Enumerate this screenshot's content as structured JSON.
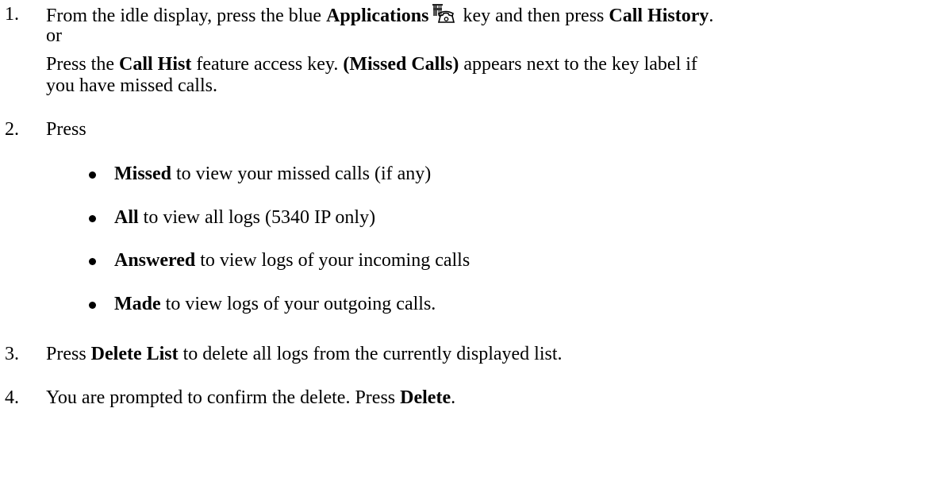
{
  "steps": [
    {
      "number": "1.",
      "line1": {
        "a": "From the idle display, press the blue ",
        "b": "Applications",
        "c": " key and then press ",
        "d": "Call History",
        "e": "."
      },
      "or": "or",
      "line3": {
        "a": "Press the ",
        "b": "Call Hist",
        "c": " feature access key. ",
        "d": "(Missed Calls)",
        "e": " appears next to the key label if"
      },
      "line4": "you have missed calls."
    },
    {
      "number": "2.",
      "text": "Press",
      "bullets": [
        {
          "bold": "Missed",
          "rest": " to view your missed calls (if any)"
        },
        {
          "bold": "All",
          "rest": " to view all logs (5340 IP only)"
        },
        {
          "bold": "Answered",
          "rest": " to view logs of your incoming calls"
        },
        {
          "bold": "Made",
          "rest": " to view logs of your outgoing calls."
        }
      ]
    },
    {
      "number": "3.",
      "a": "Press ",
      "b": "Delete List",
      "c": " to delete all logs from the currently displayed list."
    },
    {
      "number": "4.",
      "a": "You are prompted to confirm the delete. Press ",
      "b": "Delete",
      "c": "."
    }
  ],
  "icons": {
    "applications": "applications-phone-icon"
  }
}
